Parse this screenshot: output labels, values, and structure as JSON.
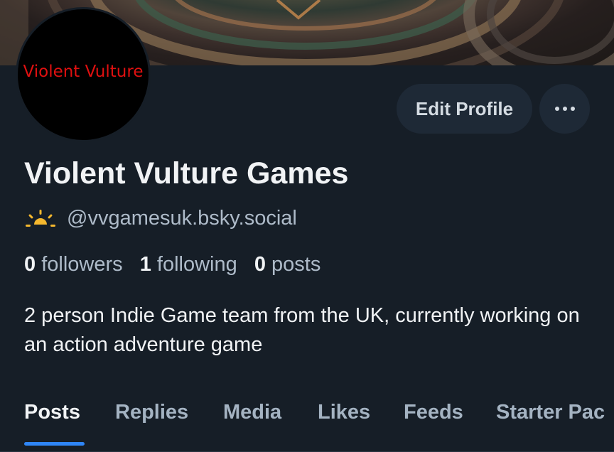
{
  "profile": {
    "avatar_text": "Violent Vulture",
    "display_name": "Violent Vulture Games",
    "handle": "@vvgamesuk.bsky.social",
    "bio": "2 person Indie Game team from the UK, currently working on an action adventure game"
  },
  "actions": {
    "edit_profile_label": "Edit Profile",
    "more_icon": "ellipsis-icon"
  },
  "stats": {
    "followers_count": "0",
    "followers_label": "followers",
    "following_count": "1",
    "following_label": "following",
    "posts_count": "0",
    "posts_label": "posts"
  },
  "tabs": [
    {
      "label": "Posts",
      "active": true
    },
    {
      "label": "Replies",
      "active": false
    },
    {
      "label": "Media",
      "active": false
    },
    {
      "label": "Likes",
      "active": false
    },
    {
      "label": "Feeds",
      "active": false
    },
    {
      "label": "Starter Pac",
      "active": false
    }
  ],
  "icons": {
    "handle_icon": "sunrise-icon"
  },
  "colors": {
    "background": "#161e27",
    "accent": "#2f86f7",
    "avatar_text": "#e01010",
    "sun_icon": "#f5b82e"
  }
}
